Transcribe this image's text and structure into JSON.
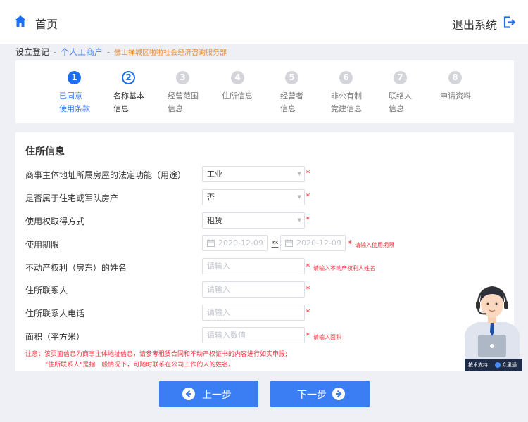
{
  "header": {
    "home_label": "首页",
    "logout_label": "退出系统"
  },
  "breadcrumb": {
    "part1": "设立登记",
    "part2": "个人工商户",
    "part3": "佛山禅城区啦啦社会经济咨询服务部",
    "separator": "-"
  },
  "steps": [
    {
      "num": "1",
      "label": "已同意\n使用条款",
      "state": "done"
    },
    {
      "num": "2",
      "label": "名称基本\n信息",
      "state": "current"
    },
    {
      "num": "3",
      "label": "经营范围\n信息",
      "state": "todo"
    },
    {
      "num": "4",
      "label": "住所信息",
      "state": "todo"
    },
    {
      "num": "5",
      "label": "经营者\n信息",
      "state": "todo"
    },
    {
      "num": "6",
      "label": "非公有制\n党建信息",
      "state": "todo"
    },
    {
      "num": "7",
      "label": "联络人\n信息",
      "state": "todo"
    },
    {
      "num": "8",
      "label": "申请资料",
      "state": "todo"
    }
  ],
  "form": {
    "title": "住所信息",
    "fields": {
      "usage": {
        "label": "商事主体地址所属房屋的法定功能（用途）",
        "value": "工业"
      },
      "residential": {
        "label": "是否属于住宅或军队房产",
        "value": "否"
      },
      "right_method": {
        "label": "使用权取得方式",
        "value": "租赁"
      },
      "period": {
        "label": "使用期限",
        "start_placeholder": "2020-12-09",
        "to": "至",
        "end_placeholder": "2020-12-09",
        "hint": "请输入使用期限"
      },
      "owner_name": {
        "label": "不动产权利（房东）的姓名",
        "placeholder": "请输入",
        "hint": "请输入不动产权利人姓名"
      },
      "contact": {
        "label": "住所联系人",
        "placeholder": "请输入"
      },
      "contact_phone": {
        "label": "住所联系人电话",
        "placeholder": "请输入"
      },
      "area": {
        "label": "面积（平方米）",
        "placeholder": "请输入数值",
        "hint": "请输入面积"
      }
    },
    "required_mark": "*",
    "note_line1": "注意：该页面信息为商事主体地址信息，请参考租赁合同和不动产权证书的内容进行如实申报;",
    "note_line2": "\"住所联系人\"是指一般情况下，可随时联系在公司工作的人的姓名。"
  },
  "buttons": {
    "prev": "上一步",
    "next": "下一步"
  },
  "support": {
    "label": "技术支持",
    "brand": "众里通"
  },
  "colors": {
    "primary": "#1c6ef3",
    "button": "#3b7df3",
    "required": "#f5313b",
    "link_orange": "#e6872f"
  }
}
